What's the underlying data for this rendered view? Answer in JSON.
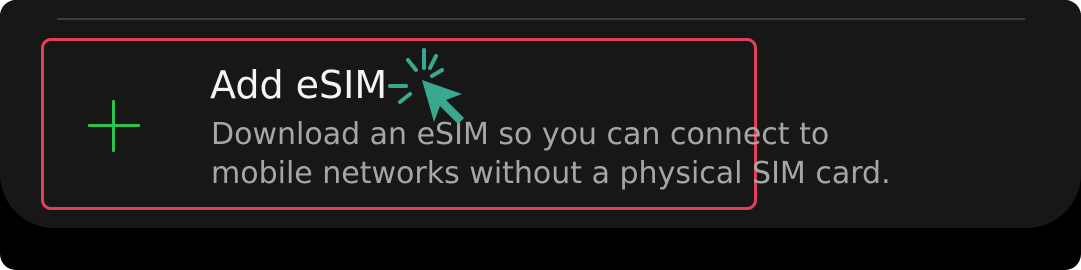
{
  "esim": {
    "title": "Add eSIM",
    "description": "Download an eSIM so you can connect to mobile networks without a physical SIM card."
  },
  "icons": {
    "add": "plus-icon",
    "pointer": "click-cursor-icon"
  },
  "colors": {
    "highlight_border": "#e2405a",
    "plus": "#2bc24f",
    "cursor": "#3aa88f",
    "title": "#f4f4f4",
    "description": "#a6a6a6",
    "card_background": "#171717"
  }
}
